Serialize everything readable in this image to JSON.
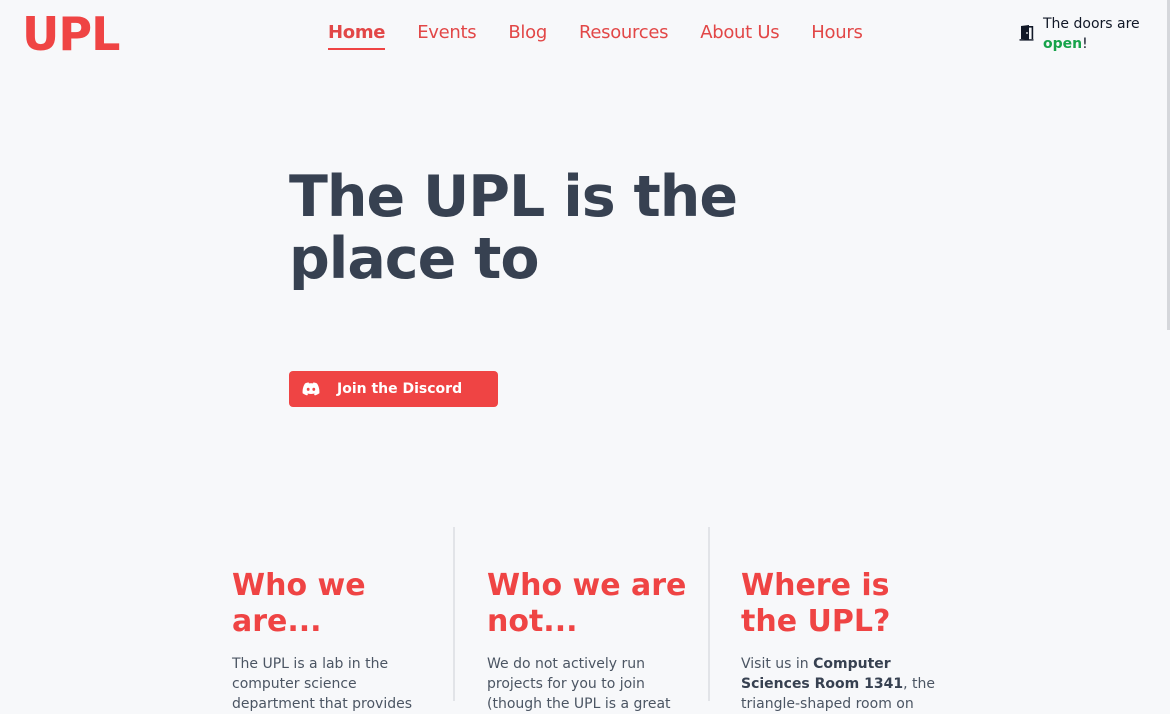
{
  "logo": "UPL",
  "nav": {
    "items": [
      {
        "label": "Home",
        "active": true
      },
      {
        "label": "Events",
        "active": false
      },
      {
        "label": "Blog",
        "active": false
      },
      {
        "label": "Resources",
        "active": false
      },
      {
        "label": "About Us",
        "active": false
      },
      {
        "label": "Hours",
        "active": false
      }
    ]
  },
  "status": {
    "prefix": "The doors are",
    "state": "open",
    "suffix": "!",
    "icon": "door-icon"
  },
  "hero": {
    "title": "The UPL is the place to",
    "button_label": "Join the Discord",
    "button_icon": "discord-icon"
  },
  "columns": [
    {
      "title": "Who we are...",
      "body": "The UPL is a lab in the computer science department that provides"
    },
    {
      "title": "Who we are not...",
      "body": "We do not actively run projects for you to join (though the UPL is a great"
    },
    {
      "title": "Where is the UPL?",
      "body_prefix": "Visit us in ",
      "body_bold": "Computer Sciences Room 1341",
      "body_suffix": ", the triangle-shaped room on"
    }
  ],
  "colors": {
    "accent": "#ef4444",
    "heading": "#374151",
    "open": "#16a34a",
    "background": "#f7f8fa"
  }
}
